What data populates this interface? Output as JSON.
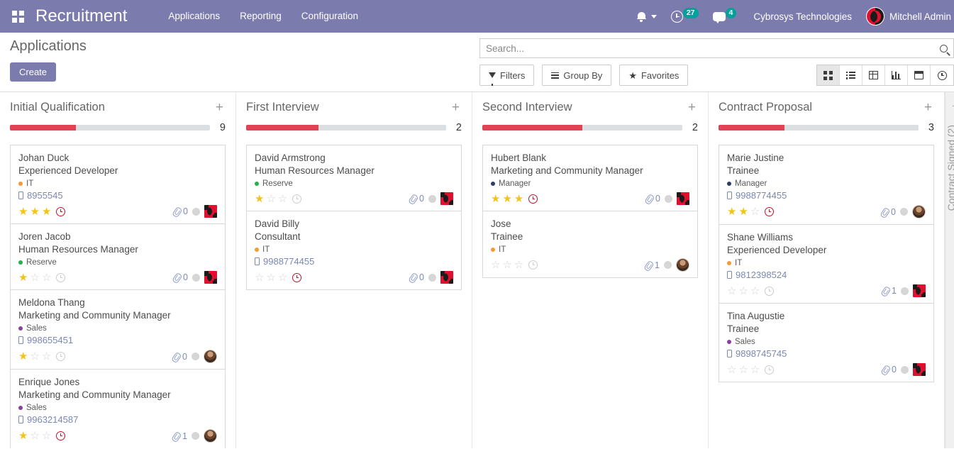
{
  "navbar": {
    "apps_icon": "apps-grid-icon",
    "brand": "Recruitment",
    "menus": [
      {
        "label": "Applications"
      },
      {
        "label": "Reporting"
      },
      {
        "label": "Configuration"
      }
    ],
    "bell_icon": "bell-icon",
    "activity_icon": "clock-activity-icon",
    "activity_count": "27",
    "messages_icon": "chat-bubble-icon",
    "messages_count": "4",
    "company": "Cybrosys Technologies",
    "username": "Mitchell Admin",
    "accent_color": "#7c7bad",
    "badge_color": "#00a09d"
  },
  "control_panel": {
    "page_title": "Applications",
    "create_label": "Create",
    "search": {
      "placeholder": "Search...",
      "value": "",
      "icon": "search-icon"
    },
    "filters_label": "Filters",
    "group_by_label": "Group By",
    "favorites_label": "Favorites",
    "views": [
      {
        "name": "kanban",
        "icon": "kanban-view-icon",
        "active": true
      },
      {
        "name": "list",
        "icon": "list-view-icon",
        "active": false
      },
      {
        "name": "pivot",
        "icon": "pivot-view-icon",
        "active": false
      },
      {
        "name": "graph",
        "icon": "graph-view-icon",
        "active": false
      },
      {
        "name": "calendar",
        "icon": "calendar-view-icon",
        "active": false
      },
      {
        "name": "activity",
        "icon": "activity-view-icon",
        "active": false
      }
    ]
  },
  "kanban": {
    "progress_color": "#e24354",
    "track_color": "#dcdfe2",
    "columns": [
      {
        "title": "Initial Qualification",
        "count": "9",
        "progress_percent": 33,
        "add_icon": "plus-icon",
        "cards": [
          {
            "name": "Johan Duck",
            "job": "Experienced Developer",
            "tag": "IT",
            "tag_color": "#f59b34",
            "phone": "8955545",
            "stars": 3,
            "clock": "red",
            "attachments": "0",
            "avatar": "logo"
          },
          {
            "name": "Joren Jacob",
            "job": "Human Resources Manager",
            "tag": "Reserve",
            "tag_color": "#25b04a",
            "phone": "",
            "stars": 1,
            "clock": "gray",
            "attachments": "0",
            "avatar": "logo"
          },
          {
            "name": "Meldona Thang",
            "job": "Marketing and Community Manager",
            "tag": "Sales",
            "tag_color": "#8b3f9e",
            "phone": "998655451",
            "stars": 1,
            "clock": "gray",
            "attachments": "0",
            "avatar": "photo"
          },
          {
            "name": "Enrique Jones",
            "job": "Marketing and Community Manager",
            "tag": "Sales",
            "tag_color": "#8b3f9e",
            "phone": "9963214587",
            "stars": 1,
            "clock": "red",
            "attachments": "1",
            "avatar": "photo"
          }
        ]
      },
      {
        "title": "First Interview",
        "count": "2",
        "progress_percent": 36,
        "add_icon": "plus-icon",
        "cards": [
          {
            "name": "David Armstrong",
            "job": "Human Resources Manager",
            "tag": "Reserve",
            "tag_color": "#25b04a",
            "phone": "",
            "stars": 1,
            "clock": "gray",
            "attachments": "0",
            "avatar": "logo"
          },
          {
            "name": "David Billy",
            "job": "Consultant",
            "tag": "IT",
            "tag_color": "#f59b34",
            "phone": "9988774455",
            "stars": 0,
            "clock": "red",
            "attachments": "0",
            "avatar": "logo"
          }
        ]
      },
      {
        "title": "Second Interview",
        "count": "2",
        "progress_percent": 50,
        "add_icon": "plus-icon",
        "cards": [
          {
            "name": "Hubert Blank",
            "job": "Marketing and Community Manager",
            "tag": "Manager",
            "tag_color": "#2c3e68",
            "phone": "",
            "stars": 3,
            "clock": "red",
            "attachments": "0",
            "avatar": "logo"
          },
          {
            "name": "Jose",
            "job": "Trainee",
            "tag": "IT",
            "tag_color": "#f59b34",
            "phone": "",
            "stars": 0,
            "clock": "gray",
            "attachments": "1",
            "avatar": "photo"
          }
        ]
      },
      {
        "title": "Contract Proposal",
        "count": "3",
        "progress_percent": 33,
        "add_icon": "plus-icon",
        "cards": [
          {
            "name": "Marie Justine",
            "job": "Trainee",
            "tag": "Manager",
            "tag_color": "#2c3e68",
            "phone": "9988774455",
            "stars": 2,
            "clock": "red",
            "attachments": "0",
            "avatar": "photo"
          },
          {
            "name": "Shane Williams",
            "job": "Experienced Developer",
            "tag": "IT",
            "tag_color": "#f59b34",
            "phone": "9812398524",
            "stars": 0,
            "clock": "gray",
            "attachments": "1",
            "avatar": "logo"
          },
          {
            "name": "Tina Augustie",
            "job": "Trainee",
            "tag": "Sales",
            "tag_color": "#8b3f9e",
            "phone": "9898745745",
            "stars": 0,
            "clock": "gray",
            "attachments": "0",
            "avatar": "logo"
          }
        ]
      }
    ],
    "folded_column": {
      "title": "Contract Signed (2)",
      "add_icon": "plus-icon"
    }
  }
}
